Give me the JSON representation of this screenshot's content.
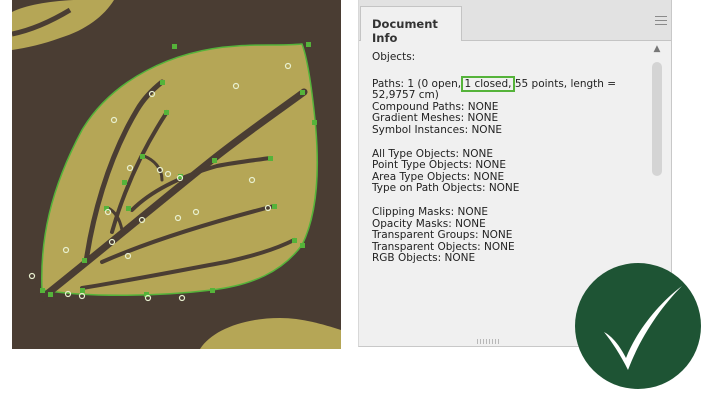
{
  "colors": {
    "background": "#4a3d33",
    "leaf": "#b5a656",
    "path": "#55b33a",
    "check_badge": "#1e5434"
  },
  "panel": {
    "tab_label": "Document Info",
    "menu_icon": "panel-menu-icon",
    "lines": {
      "objects": "Objects:",
      "paths_prefix": "Paths: 1 (0 open, ",
      "paths_closed": "1 closed,",
      "paths_suffix": " 55 points, length =",
      "paths_length": "52,9757 cm)",
      "compound": "Compound Paths: NONE",
      "gradient": "Gradient Meshes: NONE",
      "symbol": "Symbol Instances: NONE",
      "all_type": "All Type Objects: NONE",
      "point_type": "Point Type Objects: NONE",
      "area_type": "Area Type Objects: NONE",
      "type_on_path": "Type on Path Objects: NONE",
      "clipping": "Clipping Masks: NONE",
      "opacity": "Opacity Masks: NONE",
      "transparent_groups": "Transparent Groups: NONE",
      "transparent_objects": "Transparent Objects: NONE",
      "rgb": "RGB Objects: NONE"
    }
  },
  "badge": {
    "icon": "checkmark-icon"
  }
}
